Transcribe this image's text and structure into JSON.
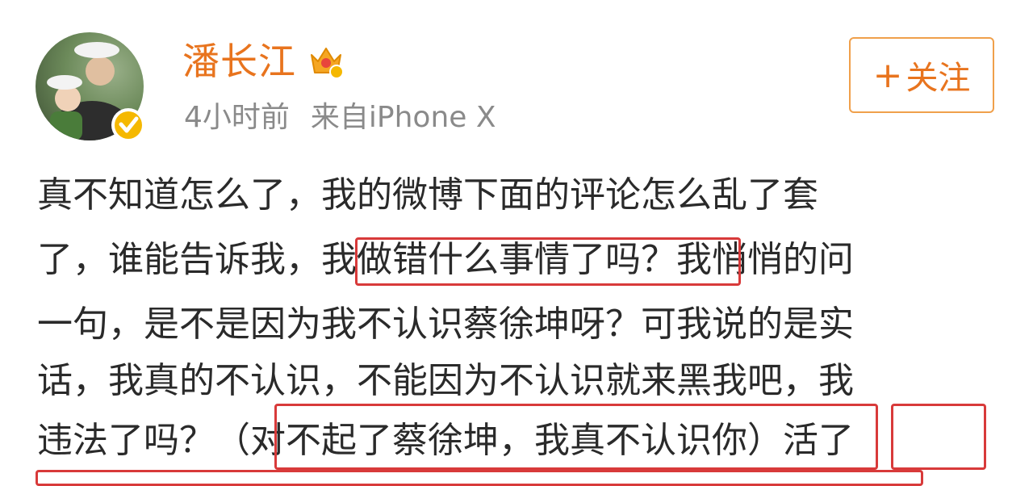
{
  "post": {
    "author": {
      "name": "潘长江"
    },
    "meta": {
      "time": "4小时前",
      "source": "来自iPhone X"
    },
    "follow_button": {
      "plus": "+",
      "label": "关注"
    },
    "body_lines": [
      "真不知道怎么了，我的微博下面的评论怎么乱了套",
      "了，谁能告诉我，我做错什么事情了吗？我悄悄的问",
      "一句，是不是因为我不认识蔡徐坤呀？可我说的是实",
      "话，我真的不认识，不能因为不认识就来黑我吧，我",
      "违法了吗？（对不起了蔡徐坤，我真不认识你）活了"
    ]
  },
  "colors": {
    "username": "#e8741e",
    "follow_border": "#f0a04b",
    "highlight": "#d83a3a",
    "meta_text": "#8a8a8a",
    "verify_badge": "#f5b800"
  },
  "icons": {
    "verified": "verified-badge-icon",
    "vip": "crown-vip-icon"
  }
}
